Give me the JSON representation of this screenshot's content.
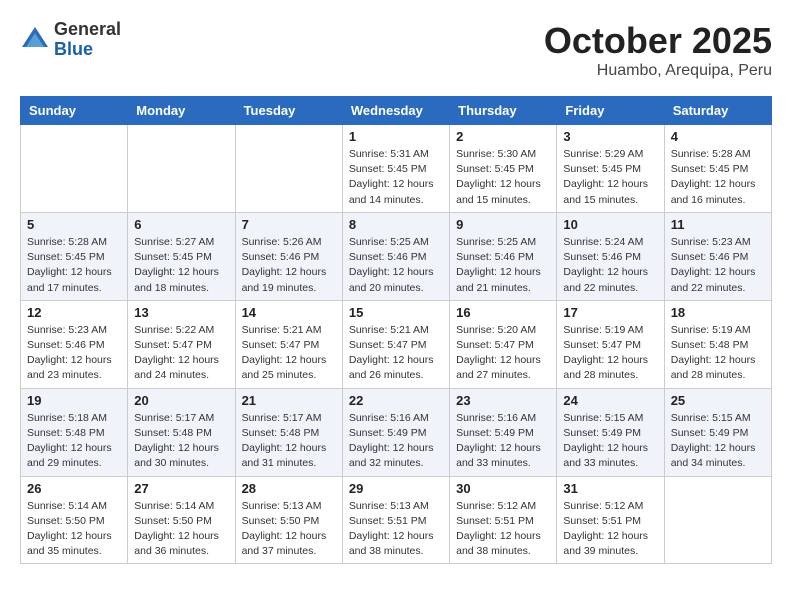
{
  "header": {
    "logo_general": "General",
    "logo_blue": "Blue",
    "month_title": "October 2025",
    "location": "Huambo, Arequipa, Peru"
  },
  "days_of_week": [
    "Sunday",
    "Monday",
    "Tuesday",
    "Wednesday",
    "Thursday",
    "Friday",
    "Saturday"
  ],
  "weeks": [
    [
      {
        "day": "",
        "info": ""
      },
      {
        "day": "",
        "info": ""
      },
      {
        "day": "",
        "info": ""
      },
      {
        "day": "1",
        "info": "Sunrise: 5:31 AM\nSunset: 5:45 PM\nDaylight: 12 hours\nand 14 minutes."
      },
      {
        "day": "2",
        "info": "Sunrise: 5:30 AM\nSunset: 5:45 PM\nDaylight: 12 hours\nand 15 minutes."
      },
      {
        "day": "3",
        "info": "Sunrise: 5:29 AM\nSunset: 5:45 PM\nDaylight: 12 hours\nand 15 minutes."
      },
      {
        "day": "4",
        "info": "Sunrise: 5:28 AM\nSunset: 5:45 PM\nDaylight: 12 hours\nand 16 minutes."
      }
    ],
    [
      {
        "day": "5",
        "info": "Sunrise: 5:28 AM\nSunset: 5:45 PM\nDaylight: 12 hours\nand 17 minutes."
      },
      {
        "day": "6",
        "info": "Sunrise: 5:27 AM\nSunset: 5:45 PM\nDaylight: 12 hours\nand 18 minutes."
      },
      {
        "day": "7",
        "info": "Sunrise: 5:26 AM\nSunset: 5:46 PM\nDaylight: 12 hours\nand 19 minutes."
      },
      {
        "day": "8",
        "info": "Sunrise: 5:25 AM\nSunset: 5:46 PM\nDaylight: 12 hours\nand 20 minutes."
      },
      {
        "day": "9",
        "info": "Sunrise: 5:25 AM\nSunset: 5:46 PM\nDaylight: 12 hours\nand 21 minutes."
      },
      {
        "day": "10",
        "info": "Sunrise: 5:24 AM\nSunset: 5:46 PM\nDaylight: 12 hours\nand 22 minutes."
      },
      {
        "day": "11",
        "info": "Sunrise: 5:23 AM\nSunset: 5:46 PM\nDaylight: 12 hours\nand 22 minutes."
      }
    ],
    [
      {
        "day": "12",
        "info": "Sunrise: 5:23 AM\nSunset: 5:46 PM\nDaylight: 12 hours\nand 23 minutes."
      },
      {
        "day": "13",
        "info": "Sunrise: 5:22 AM\nSunset: 5:47 PM\nDaylight: 12 hours\nand 24 minutes."
      },
      {
        "day": "14",
        "info": "Sunrise: 5:21 AM\nSunset: 5:47 PM\nDaylight: 12 hours\nand 25 minutes."
      },
      {
        "day": "15",
        "info": "Sunrise: 5:21 AM\nSunset: 5:47 PM\nDaylight: 12 hours\nand 26 minutes."
      },
      {
        "day": "16",
        "info": "Sunrise: 5:20 AM\nSunset: 5:47 PM\nDaylight: 12 hours\nand 27 minutes."
      },
      {
        "day": "17",
        "info": "Sunrise: 5:19 AM\nSunset: 5:47 PM\nDaylight: 12 hours\nand 28 minutes."
      },
      {
        "day": "18",
        "info": "Sunrise: 5:19 AM\nSunset: 5:48 PM\nDaylight: 12 hours\nand 28 minutes."
      }
    ],
    [
      {
        "day": "19",
        "info": "Sunrise: 5:18 AM\nSunset: 5:48 PM\nDaylight: 12 hours\nand 29 minutes."
      },
      {
        "day": "20",
        "info": "Sunrise: 5:17 AM\nSunset: 5:48 PM\nDaylight: 12 hours\nand 30 minutes."
      },
      {
        "day": "21",
        "info": "Sunrise: 5:17 AM\nSunset: 5:48 PM\nDaylight: 12 hours\nand 31 minutes."
      },
      {
        "day": "22",
        "info": "Sunrise: 5:16 AM\nSunset: 5:49 PM\nDaylight: 12 hours\nand 32 minutes."
      },
      {
        "day": "23",
        "info": "Sunrise: 5:16 AM\nSunset: 5:49 PM\nDaylight: 12 hours\nand 33 minutes."
      },
      {
        "day": "24",
        "info": "Sunrise: 5:15 AM\nSunset: 5:49 PM\nDaylight: 12 hours\nand 33 minutes."
      },
      {
        "day": "25",
        "info": "Sunrise: 5:15 AM\nSunset: 5:49 PM\nDaylight: 12 hours\nand 34 minutes."
      }
    ],
    [
      {
        "day": "26",
        "info": "Sunrise: 5:14 AM\nSunset: 5:50 PM\nDaylight: 12 hours\nand 35 minutes."
      },
      {
        "day": "27",
        "info": "Sunrise: 5:14 AM\nSunset: 5:50 PM\nDaylight: 12 hours\nand 36 minutes."
      },
      {
        "day": "28",
        "info": "Sunrise: 5:13 AM\nSunset: 5:50 PM\nDaylight: 12 hours\nand 37 minutes."
      },
      {
        "day": "29",
        "info": "Sunrise: 5:13 AM\nSunset: 5:51 PM\nDaylight: 12 hours\nand 38 minutes."
      },
      {
        "day": "30",
        "info": "Sunrise: 5:12 AM\nSunset: 5:51 PM\nDaylight: 12 hours\nand 38 minutes."
      },
      {
        "day": "31",
        "info": "Sunrise: 5:12 AM\nSunset: 5:51 PM\nDaylight: 12 hours\nand 39 minutes."
      },
      {
        "day": "",
        "info": ""
      }
    ]
  ]
}
